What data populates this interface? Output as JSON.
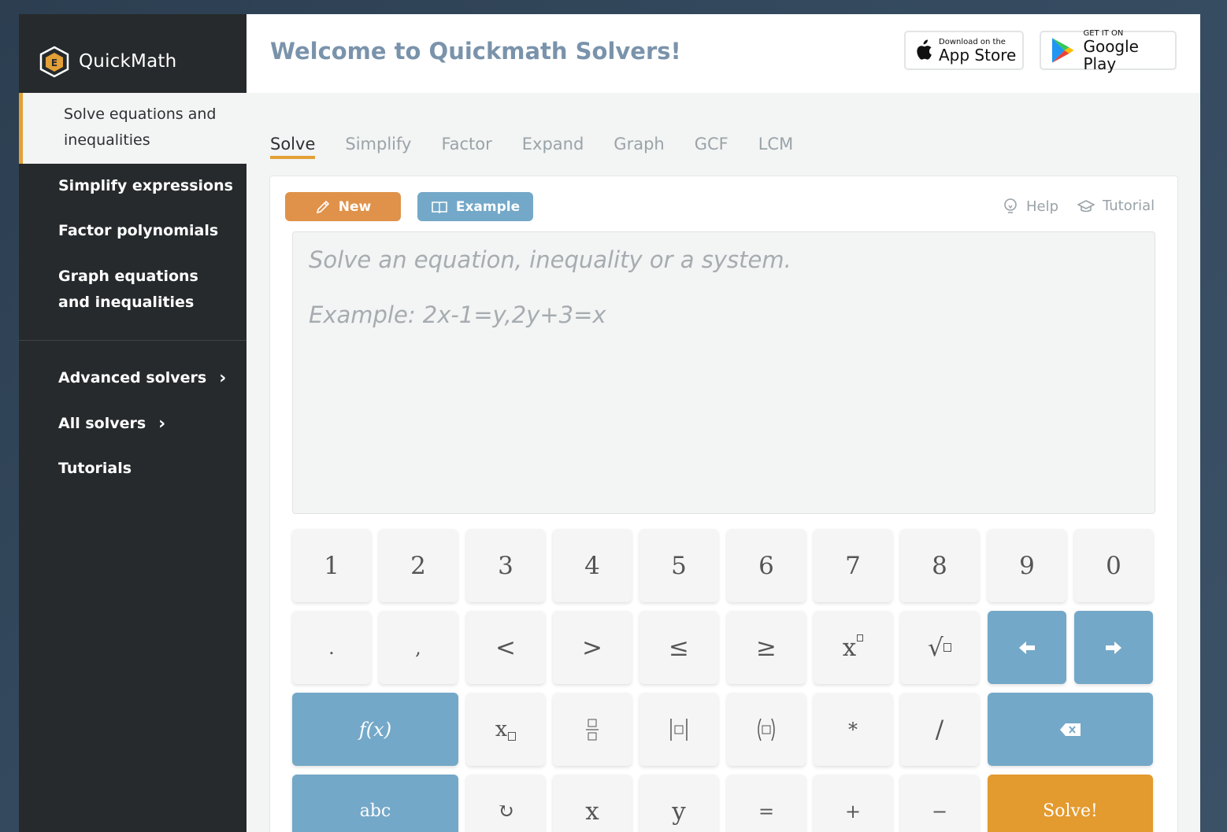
{
  "brand": {
    "name": "QuickMath"
  },
  "sidebar": {
    "items": [
      {
        "label": "Solve equations and inequalities"
      },
      {
        "label": "Simplify expressions"
      },
      {
        "label": "Factor polynomials"
      },
      {
        "label": "Graph equations and inequalities"
      }
    ],
    "secondary": [
      {
        "label": "Advanced solvers"
      },
      {
        "label": "All solvers"
      },
      {
        "label": "Tutorials"
      }
    ]
  },
  "header": {
    "title": "Welcome to Quickmath Solvers!",
    "app_store": {
      "small": "Download on the",
      "big": "App Store"
    },
    "google_play": {
      "small": "GET IT ON",
      "big": "Google Play"
    }
  },
  "tabs": [
    "Solve",
    "Simplify",
    "Factor",
    "Expand",
    "Graph",
    "GCF",
    "LCM"
  ],
  "toolbar": {
    "new_label": "New",
    "example_label": "Example",
    "help_label": "Help",
    "tutorial_label": "Tutorial"
  },
  "input": {
    "placeholder_line1": "Solve an equation, inequality or a system.",
    "placeholder_line2": "Example: 2x-1=y,2y+3=x"
  },
  "keypad": {
    "row1": [
      "1",
      "2",
      "3",
      "4",
      "5",
      "6",
      "7",
      "8",
      "9",
      "0"
    ],
    "row2": [
      ".",
      ",",
      "<",
      ">",
      "≤",
      "≥",
      "x",
      "√"
    ],
    "fx_label": "f(x)",
    "row3": [
      "x",
      "",
      "||",
      "()",
      "*",
      "/"
    ],
    "abc_label": "abc",
    "row4": [
      "↻",
      "x",
      "y",
      "=",
      "+",
      "−"
    ],
    "solve_label": "Solve!"
  },
  "colors": {
    "accent": "#e3a036",
    "blue": "#74a8c8",
    "sidebar": "#262a2c",
    "title": "#7a93ab"
  }
}
